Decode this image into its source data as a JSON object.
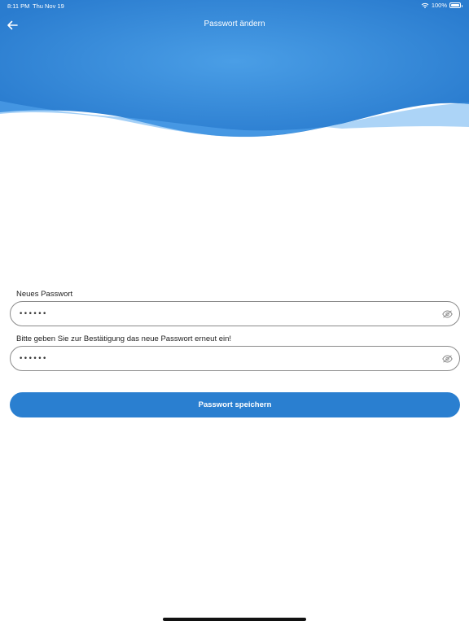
{
  "status_bar": {
    "time": "8:11 PM",
    "date": "Thu Nov 19",
    "battery": "100%"
  },
  "header": {
    "title": "Passwort ändern",
    "back_icon": "arrow-left-icon"
  },
  "form": {
    "new_password": {
      "label": "Neues Passwort",
      "value": "••••••",
      "toggle_icon": "eye-off-icon"
    },
    "confirm_password": {
      "label": "Bitte geben Sie zur Bestätigung das neue Passwort erneut ein!",
      "value": "••••••",
      "toggle_icon": "eye-off-icon"
    },
    "save_label": "Passwort speichern"
  },
  "colors": {
    "header_blue": "#2c7fd2",
    "header_light": "#4a9ee6",
    "button_blue": "#2a7fd0",
    "field_border": "#8a8a8a"
  }
}
